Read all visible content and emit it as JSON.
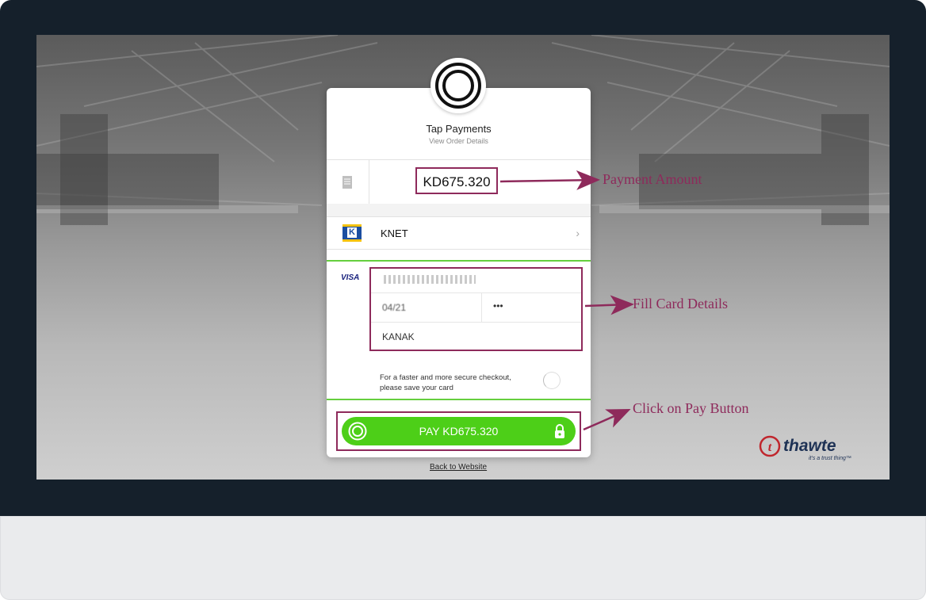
{
  "merchant": {
    "name": "Tap Payments",
    "order_link": "View Order Details"
  },
  "amount": {
    "value": "KD675.320"
  },
  "payment_methods": {
    "knet_label": "KNET",
    "knet_logo_letter": "K"
  },
  "card": {
    "brand": "VISA",
    "expiry": "04/21",
    "cvv_mask": "•••",
    "holder_name": "KANAK"
  },
  "save_card": {
    "text_line1": "For a faster and more secure checkout,",
    "text_line2": "please save your card"
  },
  "pay_button": {
    "label": "PAY KD675.320"
  },
  "back_link": "Back to Website",
  "thawte": {
    "word": "thawte",
    "tagline": "it's a trust thing™"
  },
  "annotations": {
    "payment_amount": "Payment Amount",
    "fill_card": "Fill Card Details",
    "click_pay": "Click on Pay Button"
  },
  "colors": {
    "annotation": "#8e2a5b",
    "pay_green": "#4dcf18",
    "divider_green": "#65cf3e",
    "frame": "#15202b"
  }
}
